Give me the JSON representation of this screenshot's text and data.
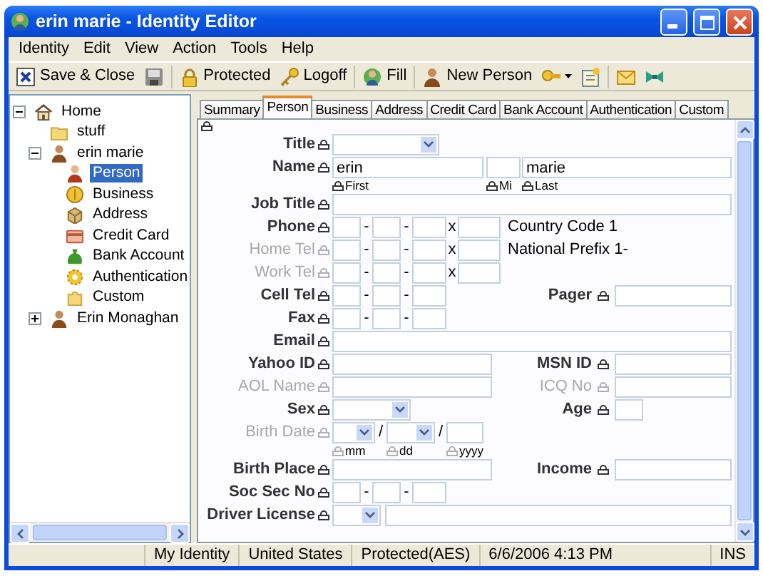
{
  "window": {
    "title": "erin marie - Identity Editor"
  },
  "menu": [
    "Identity",
    "Edit",
    "View",
    "Action",
    "Tools",
    "Help"
  ],
  "toolbar": [
    {
      "kind": "close",
      "label": "Save & Close"
    },
    {
      "kind": "disk"
    },
    {
      "kind": "separator"
    },
    {
      "kind": "lock",
      "label": "Protected"
    },
    {
      "kind": "key",
      "label": "Logoff"
    },
    {
      "kind": "separator"
    },
    {
      "kind": "fill",
      "label": "Fill"
    },
    {
      "kind": "separator"
    },
    {
      "kind": "person",
      "label": "New Person"
    },
    {
      "kind": "keys"
    },
    {
      "kind": "note"
    },
    {
      "kind": "separator"
    },
    {
      "kind": "mail"
    },
    {
      "kind": "bow"
    }
  ],
  "tree": [
    {
      "label": "Home",
      "kind": "home",
      "expanded": true,
      "selected": false,
      "children": [
        {
          "label": "stuff",
          "kind": "folder",
          "selected": false
        },
        {
          "label": "erin marie",
          "kind": "person",
          "expanded": true,
          "selected": false,
          "children": [
            {
              "label": "Person",
              "kind": "person-red",
              "selected": true
            },
            {
              "label": "Business",
              "kind": "coin",
              "selected": false
            },
            {
              "label": "Address",
              "kind": "box",
              "selected": false
            },
            {
              "label": "Credit Card",
              "kind": "card",
              "selected": false
            },
            {
              "label": "Bank Account",
              "kind": "bag",
              "selected": false
            },
            {
              "label": "Authentication",
              "kind": "gear",
              "selected": false
            },
            {
              "label": "Custom",
              "kind": "puzzle",
              "selected": false
            }
          ]
        },
        {
          "label": "Erin Monaghan",
          "kind": "person",
          "expanded": false,
          "selected": false
        }
      ]
    }
  ],
  "tabs": [
    {
      "label": "Summary",
      "selected": false
    },
    {
      "label": "Person",
      "selected": true
    },
    {
      "label": "Business",
      "selected": false
    },
    {
      "label": "Address",
      "selected": false
    },
    {
      "label": "Credit Card",
      "selected": false
    },
    {
      "label": "Bank Account",
      "selected": false
    },
    {
      "label": "Authentication",
      "selected": false
    },
    {
      "label": "Custom",
      "selected": false
    }
  ],
  "form": [
    {
      "label": "Title",
      "disabled": false,
      "kind": "select"
    },
    {
      "label": "Name",
      "disabled": false,
      "kind": "name",
      "first": "erin",
      "last": "marie",
      "sublabels": [
        "First",
        "Mi",
        "Last"
      ]
    },
    {
      "label": "Job Title",
      "disabled": false,
      "kind": "wide"
    },
    {
      "label": "Phone",
      "disabled": false,
      "kind": "phone",
      "separator": "-",
      "extension": "x",
      "note": "Country Code 1"
    },
    {
      "label": "Home Tel",
      "disabled": true,
      "kind": "phone",
      "separator": "-",
      "extension": "x",
      "note": "National Prefix 1-"
    },
    {
      "label": "Work Tel",
      "disabled": true,
      "kind": "phone",
      "separator": "-",
      "extension": "x"
    },
    {
      "label": "Cell Tel",
      "disabled": false,
      "kind": "phone",
      "separator": "-",
      "right": {
        "label": "Pager",
        "disabled": false,
        "kind": "wide"
      }
    },
    {
      "label": "Fax",
      "disabled": false,
      "kind": "phone",
      "separator": "-"
    },
    {
      "label": "Email",
      "disabled": false,
      "kind": "wide"
    },
    {
      "label": "Yahoo ID",
      "disabled": false,
      "kind": "half",
      "right": {
        "label": "MSN ID",
        "disabled": false,
        "kind": "wide"
      }
    },
    {
      "label": "AOL Name",
      "disabled": true,
      "kind": "half",
      "right": {
        "label": "ICQ No",
        "disabled": true,
        "kind": "wide"
      }
    },
    {
      "label": "Sex",
      "disabled": false,
      "kind": "short-select",
      "right": {
        "label": "Age",
        "disabled": false,
        "kind": "small"
      }
    },
    {
      "label": "Birth Date",
      "disabled": true,
      "kind": "date",
      "separator": "/",
      "sublabels": [
        "mm",
        "dd",
        "yyyy"
      ]
    },
    {
      "label": "Birth Place",
      "disabled": false,
      "kind": "half",
      "right": {
        "label": "Income",
        "disabled": false,
        "kind": "wide"
      }
    },
    {
      "label": "Soc Sec No",
      "disabled": false,
      "kind": "ssn",
      "separator": "-"
    },
    {
      "label": "Driver License",
      "disabled": false,
      "kind": "select-text"
    }
  ],
  "status_bar": [
    "My Identity",
    "United States",
    "Protected(AES)",
    "6/6/2006 4:13 PM",
    "INS"
  ]
}
